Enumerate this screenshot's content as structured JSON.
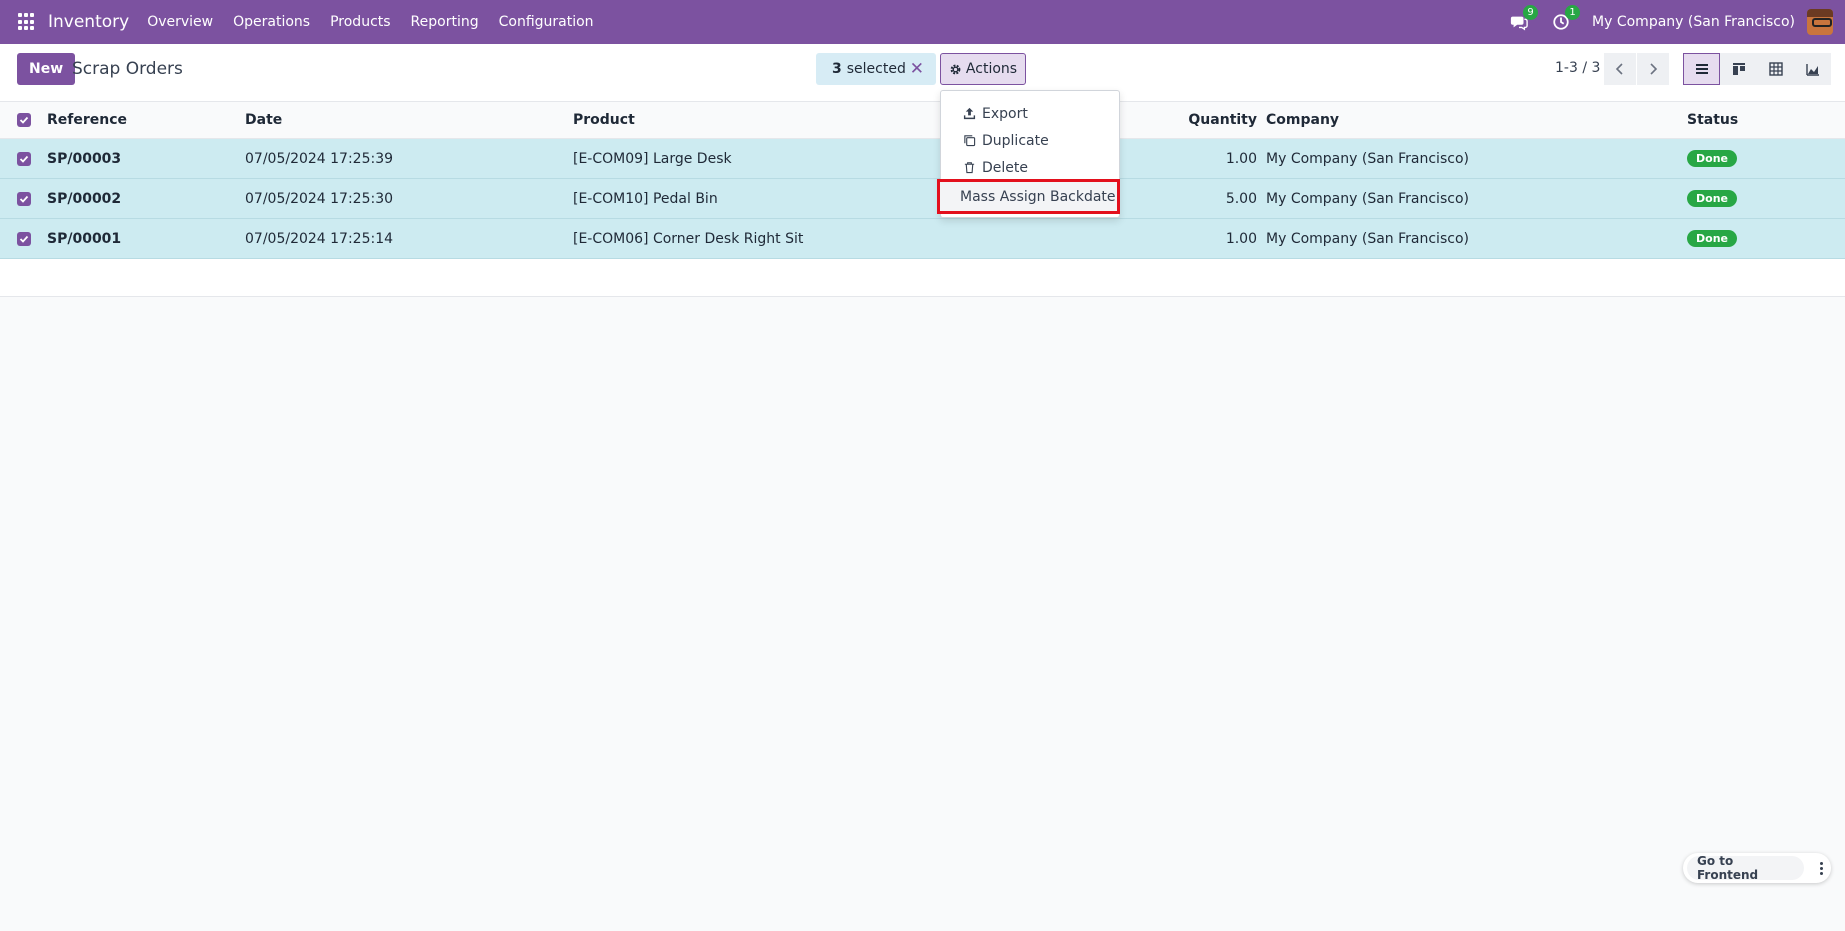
{
  "navbar": {
    "app_name": "Inventory",
    "menu": [
      "Overview",
      "Operations",
      "Products",
      "Reporting",
      "Configuration"
    ],
    "messages_count": "9",
    "activities_count": "1",
    "company": "My Company (San Francisco)"
  },
  "control_panel": {
    "new_label": "New",
    "title": "Scrap Orders",
    "selected_count": "3",
    "selected_label": "selected",
    "actions_label": "Actions",
    "pager": "1-3 / 3"
  },
  "actions_menu": {
    "items": [
      "Export",
      "Duplicate",
      "Delete"
    ],
    "highlighted": "Mass Assign Backdate"
  },
  "table": {
    "headers": {
      "reference": "Reference",
      "date": "Date",
      "product": "Product",
      "quantity": "Quantity",
      "company": "Company",
      "status": "Status"
    },
    "rows": [
      {
        "reference": "SP/00003",
        "date": "07/05/2024 17:25:39",
        "product": "[E-COM09] Large Desk",
        "quantity": "1.00",
        "company": "My Company (San Francisco)",
        "status": "Done"
      },
      {
        "reference": "SP/00002",
        "date": "07/05/2024 17:25:30",
        "product": "[E-COM10] Pedal Bin",
        "quantity": "5.00",
        "company": "My Company (San Francisco)",
        "status": "Done"
      },
      {
        "reference": "SP/00001",
        "date": "07/05/2024 17:25:14",
        "product": "[E-COM06] Corner Desk Right Sit",
        "quantity": "1.00",
        "company": "My Company (San Francisco)",
        "status": "Done"
      }
    ]
  },
  "footer": {
    "frontend_label": "Go to Frontend"
  },
  "colors": {
    "brand": "#7c52a0",
    "selected_row": "#cdebf1",
    "status_done": "#28a745",
    "highlight_border": "#e3101d"
  },
  "icons": [
    "apps-grid-icon",
    "chat-icon",
    "clock-icon",
    "gear-icon",
    "upload-icon",
    "copy-icon",
    "trash-icon",
    "chevron-left-icon",
    "chevron-right-icon",
    "list-view-icon",
    "kanban-view-icon",
    "pivot-view-icon",
    "graph-view-icon",
    "close-icon",
    "kebab-icon",
    "checkmark-icon"
  ]
}
